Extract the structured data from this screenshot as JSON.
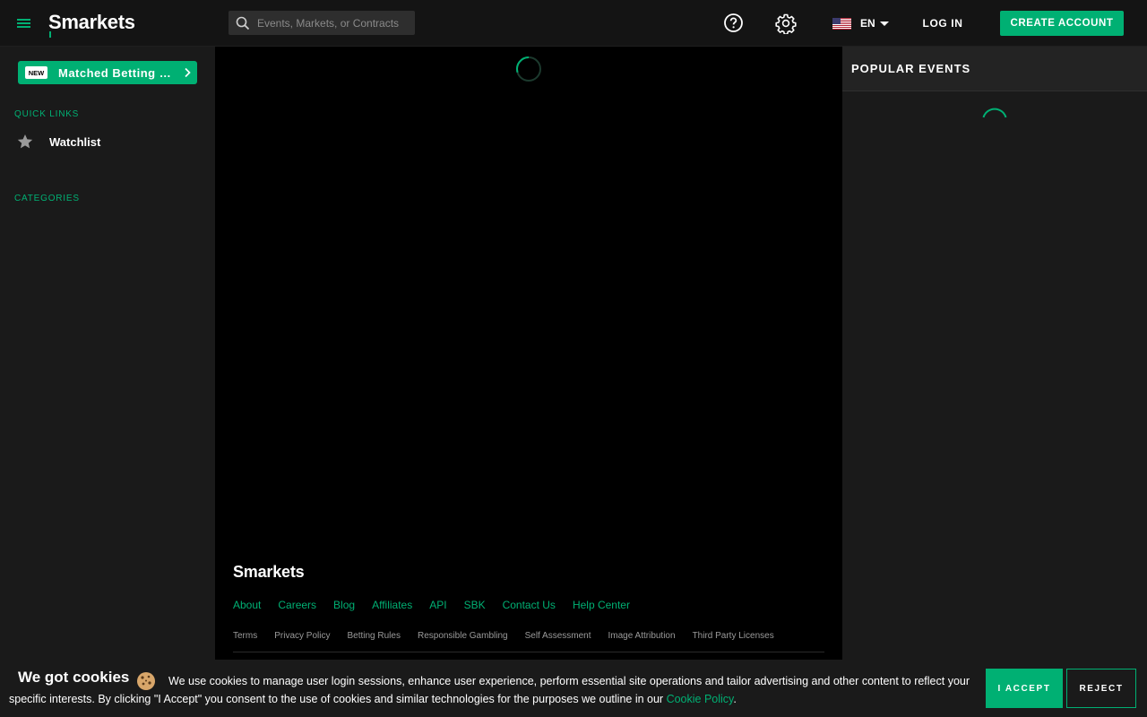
{
  "header": {
    "logo": "Smarkets",
    "search": {
      "placeholder": "Events, Markets, or Contracts"
    },
    "language": "EN",
    "login_label": "LOG IN",
    "create_account_label": "CREATE ACCOUNT"
  },
  "sidebar": {
    "promo": {
      "badge": "NEW",
      "label": "Matched Betting Hub"
    },
    "quick_links_heading": "QUICK LINKS",
    "watchlist_label": "Watchlist",
    "categories_heading": "CATEGORIES"
  },
  "footer": {
    "logo": "Smarkets",
    "links": [
      "About",
      "Careers",
      "Blog",
      "Affiliates",
      "API",
      "SBK",
      "Contact Us",
      "Help Center"
    ],
    "legal": [
      "Terms",
      "Privacy Policy",
      "Betting Rules",
      "Responsible Gambling",
      "Self Assessment",
      "Image Attribution",
      "Third Party Licenses"
    ]
  },
  "rightbar": {
    "popular_heading": "POPULAR EVENTS"
  },
  "cookie": {
    "title": "We got cookies",
    "text": "We use cookies to manage user login sessions, enhance user experience, perform essential site operations and tailor advertising and other content to reflect your specific interests. By clicking \"I Accept\" you consent to the use of cookies and similar technologies for the purposes we outline in our ",
    "link": "Cookie Policy",
    "after": ".",
    "accept_label": "I ACCEPT",
    "reject_label": "REJECT"
  },
  "colors": {
    "brand": "#00b073",
    "header_bg": "#141414",
    "sidebar_bg": "#1a1a1a",
    "main_bg": "#000000"
  },
  "icons": [
    "menu-icon",
    "search-icon",
    "help-icon",
    "gear-icon",
    "us-flag-icon",
    "chevron-right-icon",
    "star-icon",
    "cookie-icon",
    "loading-spinner"
  ]
}
